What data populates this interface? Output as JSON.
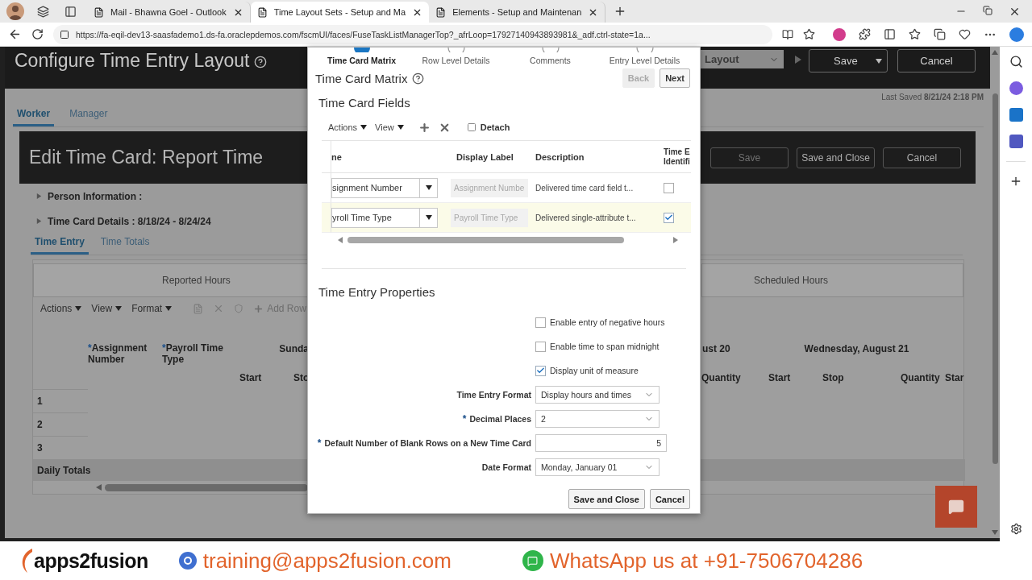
{
  "browser": {
    "tabs": [
      {
        "title": "Mail - Bhawna Goel - Outlook",
        "selected": false
      },
      {
        "title": "Time Layout Sets - Setup and Ma",
        "selected": true
      },
      {
        "title": "Elements - Setup and Maintenan",
        "selected": false
      }
    ],
    "url": "https://fa-eqil-dev13-saasfademo1.ds-fa.oraclepdemos.com/fscmUI/faces/FuseTaskListManagerTop?_afrLoop=17927140943893981&_adf.ctrl-state=1a..."
  },
  "page": {
    "title": "Configure Time Entry Layout",
    "layout_select": "Layout",
    "buttons": [
      "Save",
      "Cancel"
    ],
    "tabs": [
      {
        "label": "Worker",
        "selected": true
      },
      {
        "label": "Manager",
        "selected": false
      }
    ],
    "last_saved_label": "Last Saved",
    "last_saved_value": "8/21/24 2:18 PM"
  },
  "preview": {
    "title": "Edit Time Card: Report Time",
    "buttons": [
      {
        "label": "Save",
        "disabled": true
      },
      {
        "label": "Save and Close",
        "disabled": false
      },
      {
        "label": "Cancel",
        "disabled": false
      }
    ],
    "sections": [
      {
        "label": "Person Information :",
        "expanded": false
      },
      {
        "label": "Time Card Details : 8/18/24 - 8/24/24",
        "expanded": false
      }
    ],
    "tabs": [
      {
        "label": "Time Entry",
        "selected": true
      },
      {
        "label": "Time Totals",
        "selected": false
      }
    ],
    "group_headers": [
      "Reported Hours",
      "Scheduled Hours"
    ],
    "toolbar": [
      "Actions",
      "View",
      "Format"
    ],
    "add_row": "Add Row",
    "required_mark": "*",
    "columns": [
      {
        "label": "Assignment Number",
        "required": true
      },
      {
        "label": "Payroll Time Type",
        "required": true
      }
    ],
    "days": [
      "Sunda",
      "ust 20",
      "Wednesday, August 21"
    ],
    "subcolumns_left": [
      "Start",
      "Sto"
    ],
    "subcolumns_right": [
      "Quantity",
      "Start",
      "Stop",
      "Quantity",
      "Star"
    ],
    "rows": [
      "1",
      "2",
      "3"
    ],
    "totals_label": "Daily Totals"
  },
  "dialog": {
    "steps": [
      {
        "label": "Time Card Matrix",
        "selected": true
      },
      {
        "label": "Row Level Details",
        "selected": false
      },
      {
        "label": "Comments",
        "selected": false
      },
      {
        "label": "Entry Level Details",
        "selected": false
      }
    ],
    "title": "Time Card Matrix",
    "back": {
      "label": "Back",
      "disabled": true
    },
    "next": {
      "label": "Next",
      "disabled": false
    },
    "fields_title": "Time Card Fields",
    "toolbar": [
      "Actions",
      "View"
    ],
    "detach": "Detach",
    "columns": [
      "ne",
      "Display Label",
      "Description",
      "Time E Identifi"
    ],
    "rows": [
      {
        "name": "signment Number",
        "display_label": "Assignment Numbe",
        "description": "Delivered time card field t...",
        "identifier": false,
        "selected": false
      },
      {
        "name": "yroll Time Type",
        "display_label": "Payroll Time Type",
        "description": "Delivered single-attribute t...",
        "identifier": true,
        "selected": true
      }
    ],
    "properties_title": "Time Entry Properties",
    "required_mark": "*",
    "options": [
      {
        "label": "Enable entry of negative hours",
        "checked": false
      },
      {
        "label": "Enable time to span midnight",
        "checked": false
      },
      {
        "label": "Display unit of measure",
        "checked": true
      }
    ],
    "fields": [
      {
        "label": "Time Entry Format",
        "kind": "select",
        "value": "Display hours and times",
        "required": false
      },
      {
        "label": "Decimal Places",
        "kind": "select",
        "value": "2",
        "required": true
      },
      {
        "label": "Default Number of Blank Rows on a New Time Card",
        "kind": "input",
        "value": "5",
        "required": true
      },
      {
        "label": "Date Format",
        "kind": "select",
        "value": "Monday, January 01",
        "required": false
      }
    ],
    "buttons": [
      "Save and Close",
      "Cancel"
    ]
  },
  "banner": {
    "logo": "apps2fusion",
    "email": "training@apps2fusion.com",
    "whatsapp": "WhatsApp us at +91-7506704286"
  }
}
